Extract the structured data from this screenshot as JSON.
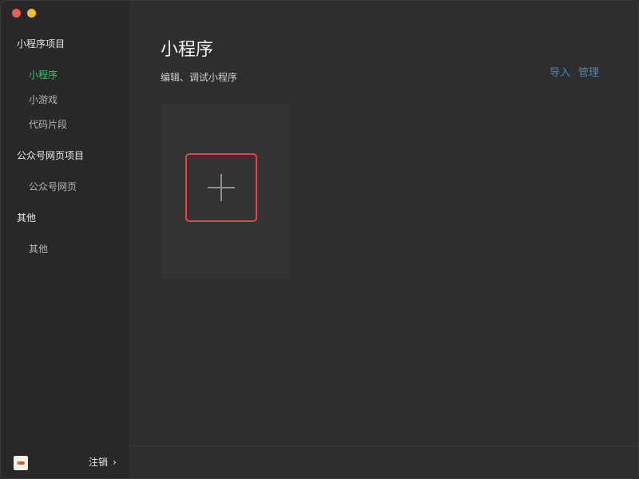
{
  "sidebar": {
    "sections": [
      {
        "title": "小程序项目",
        "items": [
          "小程序",
          "小游戏",
          "代码片段"
        ]
      },
      {
        "title": "公众号网页项目",
        "items": [
          "公众号网页"
        ]
      },
      {
        "title": "其他",
        "items": [
          "其他"
        ]
      }
    ],
    "active_item": "小程序",
    "logout_label": "注销",
    "logout_chevron": "›",
    "avatar_icon": "user-avatar-icon"
  },
  "main": {
    "title": "小程序",
    "subtitle": "编辑、调试小程序",
    "links": {
      "import": "导入",
      "manage": "管理"
    },
    "create_button_icon": "plus-icon"
  },
  "colors": {
    "accent_active": "#3bc371",
    "link": "#4f86b3",
    "highlight": "#e04650",
    "window_close": "#ee5e57",
    "window_minimize": "#f4bd2f"
  }
}
